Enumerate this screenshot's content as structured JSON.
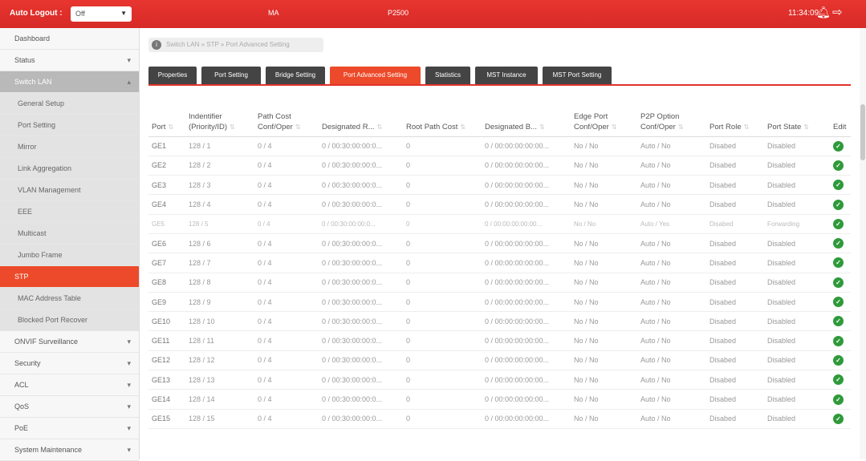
{
  "topbar": {
    "auto_logout_label": "Auto Logout :",
    "auto_logout_value": "Off",
    "model": "MA",
    "device": "P2500",
    "time": "11:34:09"
  },
  "sidebar": {
    "items": [
      {
        "label": "Dashboard",
        "chevron": "",
        "state": "normal"
      },
      {
        "label": "Status",
        "chevron": "▾",
        "state": "normal"
      },
      {
        "label": "Switch LAN",
        "chevron": "▴",
        "state": "section-open"
      },
      {
        "label": "General Setup",
        "chevron": "",
        "state": "sub"
      },
      {
        "label": "Port Setting",
        "chevron": "",
        "state": "sub"
      },
      {
        "label": "Mirror",
        "chevron": "",
        "state": "sub"
      },
      {
        "label": "Link Aggregation",
        "chevron": "",
        "state": "sub"
      },
      {
        "label": "VLAN Management",
        "chevron": "",
        "state": "sub"
      },
      {
        "label": "EEE",
        "chevron": "",
        "state": "sub"
      },
      {
        "label": "Multicast",
        "chevron": "",
        "state": "sub"
      },
      {
        "label": "Jumbo Frame",
        "chevron": "",
        "state": "sub"
      },
      {
        "label": "STP",
        "chevron": "",
        "state": "active"
      },
      {
        "label": "MAC Address Table",
        "chevron": "",
        "state": "sub"
      },
      {
        "label": "Blocked Port Recover",
        "chevron": "",
        "state": "sub"
      },
      {
        "label": "ONVIF Surveillance",
        "chevron": "▾",
        "state": "normal"
      },
      {
        "label": "Security",
        "chevron": "▾",
        "state": "normal"
      },
      {
        "label": "ACL",
        "chevron": "▾",
        "state": "normal"
      },
      {
        "label": "QoS",
        "chevron": "▾",
        "state": "normal"
      },
      {
        "label": "PoE",
        "chevron": "▾",
        "state": "normal"
      },
      {
        "label": "System Maintenance",
        "chevron": "▾",
        "state": "normal"
      }
    ]
  },
  "breadcrumb": "Switch LAN » STP » Port Advanced Setting",
  "tabs": [
    {
      "label": "Properties",
      "active": false
    },
    {
      "label": "Port Setting",
      "active": false
    },
    {
      "label": "Bridge Setting",
      "active": false
    },
    {
      "label": "Port Advanced Setting",
      "active": true
    },
    {
      "label": "Statistics",
      "active": false
    },
    {
      "label": "MST Instance",
      "active": false
    },
    {
      "label": "MST Port Setting",
      "active": false
    }
  ],
  "table": {
    "columns": [
      {
        "label": "Port",
        "sortable": true
      },
      {
        "label": "Indentifier (Priority/ID)",
        "sortable": true
      },
      {
        "label": "Path Cost Conf/Oper",
        "sortable": true
      },
      {
        "label": "Designated R...",
        "sortable": true
      },
      {
        "label": "Root Path Cost",
        "sortable": true
      },
      {
        "label": "Designated B...",
        "sortable": true
      },
      {
        "label": "Edge Port Conf/Oper",
        "sortable": true
      },
      {
        "label": "P2P Option Conf/Oper",
        "sortable": true
      },
      {
        "label": "Port Role",
        "sortable": true
      },
      {
        "label": "Port State",
        "sortable": true
      },
      {
        "label": "Edit",
        "sortable": false
      }
    ],
    "rows": [
      [
        "GE1",
        "128 / 1",
        "0 / 4",
        "0 / 00:30:00:00:0...",
        "0",
        "0 / 00:00:00:00:00...",
        "No / No",
        "Auto / No",
        "Disabed",
        "Disabled"
      ],
      [
        "GE2",
        "128 / 2",
        "0 / 4",
        "0 / 00:30:00:00:0...",
        "0",
        "0 / 00:00:00:00:00...",
        "No / No",
        "Auto / No",
        "Disabed",
        "Disabled"
      ],
      [
        "GE3",
        "128 / 3",
        "0 / 4",
        "0 / 00:30:00:00:0...",
        "0",
        "0 / 00:00:00:00:00...",
        "No / No",
        "Auto / No",
        "Disabed",
        "Disabled"
      ],
      [
        "GE4",
        "128 / 4",
        "0 / 4",
        "0 / 00:30:00:00:0...",
        "0",
        "0 / 00:00:00:00:00...",
        "No / No",
        "Auto / No",
        "Disabed",
        "Disabled"
      ],
      [
        "GE5",
        "128 / 5",
        "0 / 4",
        "0 / 00:30:00:00:0...",
        "0",
        "0 / 00:00:00:00:00...",
        "No / No",
        "Auto / Yes",
        "Disabed",
        "Forwarding"
      ],
      [
        "GE6",
        "128 / 6",
        "0 / 4",
        "0 / 00:30:00:00:0...",
        "0",
        "0 / 00:00:00:00:00...",
        "No / No",
        "Auto / No",
        "Disabed",
        "Disabled"
      ],
      [
        "GE7",
        "128 / 7",
        "0 / 4",
        "0 / 00:30:00:00:0...",
        "0",
        "0 / 00:00:00:00:00...",
        "No / No",
        "Auto / No",
        "Disabed",
        "Disabled"
      ],
      [
        "GE8",
        "128 / 8",
        "0 / 4",
        "0 / 00:30:00:00:0...",
        "0",
        "0 / 00:00:00:00:00...",
        "No / No",
        "Auto / No",
        "Disabed",
        "Disabled"
      ],
      [
        "GE9",
        "128 / 9",
        "0 / 4",
        "0 / 00:30:00:00:0...",
        "0",
        "0 / 00:00:00:00:00...",
        "No / No",
        "Auto / No",
        "Disabed",
        "Disabled"
      ],
      [
        "GE10",
        "128 / 10",
        "0 / 4",
        "0 / 00:30:00:00:0...",
        "0",
        "0 / 00:00:00:00:00...",
        "No / No",
        "Auto / No",
        "Disabed",
        "Disabled"
      ],
      [
        "GE11",
        "128 / 11",
        "0 / 4",
        "0 / 00:30:00:00:0...",
        "0",
        "0 / 00:00:00:00:00...",
        "No / No",
        "Auto / No",
        "Disabed",
        "Disabled"
      ],
      [
        "GE12",
        "128 / 12",
        "0 / 4",
        "0 / 00:30:00:00:0...",
        "0",
        "0 / 00:00:00:00:00...",
        "No / No",
        "Auto / No",
        "Disabed",
        "Disabled"
      ],
      [
        "GE13",
        "128 / 13",
        "0 / 4",
        "0 / 00:30:00:00:0...",
        "0",
        "0 / 00:00:00:00:00...",
        "No / No",
        "Auto / No",
        "Disabed",
        "Disabled"
      ],
      [
        "GE14",
        "128 / 14",
        "0 / 4",
        "0 / 00:30:00:00:0...",
        "0",
        "0 / 00:00:00:00:00...",
        "No / No",
        "Auto / No",
        "Disabed",
        "Disabled"
      ],
      [
        "GE15",
        "128 / 15",
        "0 / 4",
        "0 / 00:30:00:00:0...",
        "0",
        "0 / 00:00:00:00:00...",
        "No / No",
        "Auto / No",
        "Disabed",
        "Disabled"
      ]
    ],
    "faded_row_index": 4
  },
  "icons": {
    "bell": "bell-icon",
    "logout": "logout-icon",
    "edit": "check-circle-icon",
    "breadcrumb": "info-icon"
  },
  "colors": {
    "brand_red": "#d72a27",
    "active_orange": "#ec4a2a",
    "tab_dark": "#444444",
    "edit_green": "#2e9a3a"
  }
}
